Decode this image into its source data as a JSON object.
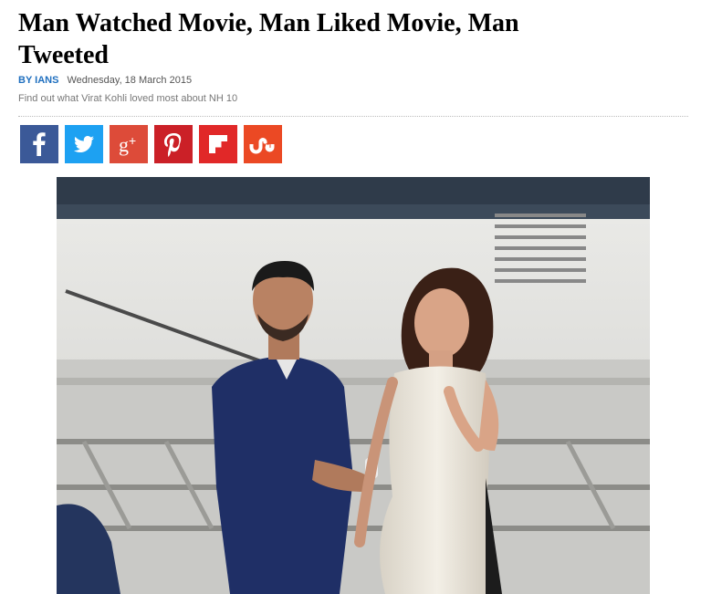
{
  "article": {
    "headline": "Man Watched Movie, Man Liked Movie, Man Tweeted",
    "byline_prefix": "BY",
    "author": "IANS",
    "date": "Wednesday, 18 March 2015",
    "summary": "Find out what Virat Kohli loved most about NH 10"
  },
  "share": {
    "buttons": [
      {
        "name": "facebook",
        "color": "#3b5998",
        "glyph": "f"
      },
      {
        "name": "twitter",
        "color": "#1da1f2",
        "glyph": "bird"
      },
      {
        "name": "google-plus",
        "color": "#dd4b39",
        "glyph": "g+"
      },
      {
        "name": "pinterest",
        "color": "#cb2027",
        "glyph": "p"
      },
      {
        "name": "flipboard",
        "color": "#e12828",
        "glyph": "flip"
      },
      {
        "name": "stumbleupon",
        "color": "#eb4924",
        "glyph": "su"
      }
    ]
  },
  "photo": {
    "icon": "article-photo"
  }
}
